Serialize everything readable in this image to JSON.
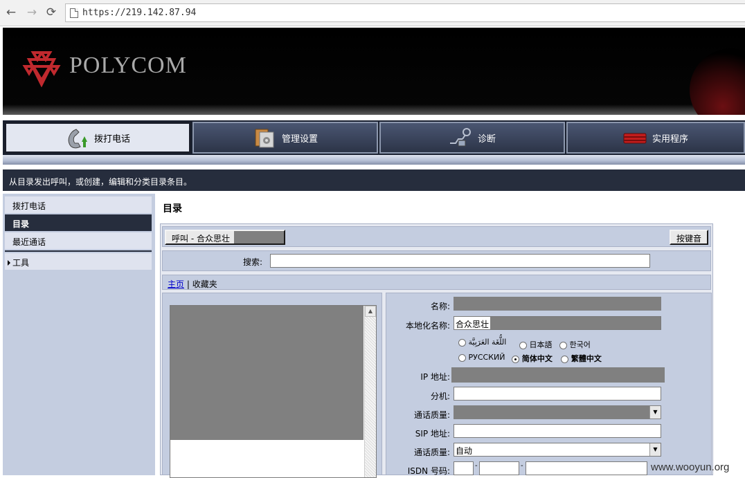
{
  "browser": {
    "url": "https://219.142.87.94"
  },
  "brand": {
    "logo_text": "POLYCOM"
  },
  "tabs": [
    {
      "label": "拨打电话",
      "icon": "phone-call-icon"
    },
    {
      "label": "管理设置",
      "icon": "admin-settings-icon"
    },
    {
      "label": "诊断",
      "icon": "diagnostics-icon"
    },
    {
      "label": "实用程序",
      "icon": "utilities-icon"
    }
  ],
  "description": "从目录发出呼叫，或创建，编辑和分类目录条目。",
  "sidebar": {
    "items": [
      {
        "label": "拨打电话"
      },
      {
        "label": "目录"
      },
      {
        "label": "最近通话"
      },
      {
        "label": "工具"
      }
    ]
  },
  "main": {
    "title": "目录",
    "call_button": "呼叫 - 合众思壮",
    "keypad_button": "按键音",
    "search_label": "搜索:",
    "search_value": "",
    "nav_home": "主页",
    "nav_sep": " | ",
    "nav_favorites": "收藏夹"
  },
  "form": {
    "name_label": "名称:",
    "local_name_label": "本地化名称:",
    "local_name_value": "合众思壮",
    "languages": [
      {
        "label": "اللُّغَة العَرَبِيَّة",
        "checked": false
      },
      {
        "label": "日本語",
        "checked": false
      },
      {
        "label": "한국어",
        "checked": false
      },
      {
        "label": "РУССКИЙ",
        "checked": false
      },
      {
        "label": "简体中文",
        "checked": true
      },
      {
        "label": "繁體中文",
        "checked": false
      }
    ],
    "ip_label": "IP 地址:",
    "ext_label": "分机:",
    "quality_label": "通话质量:",
    "sip_label": "SIP 地址:",
    "quality2_label": "通话质量:",
    "quality2_value": "自动",
    "isdn_label": "ISDN 号码:",
    "isdn_sep": "-"
  },
  "watermark": "www.wooyun.org"
}
